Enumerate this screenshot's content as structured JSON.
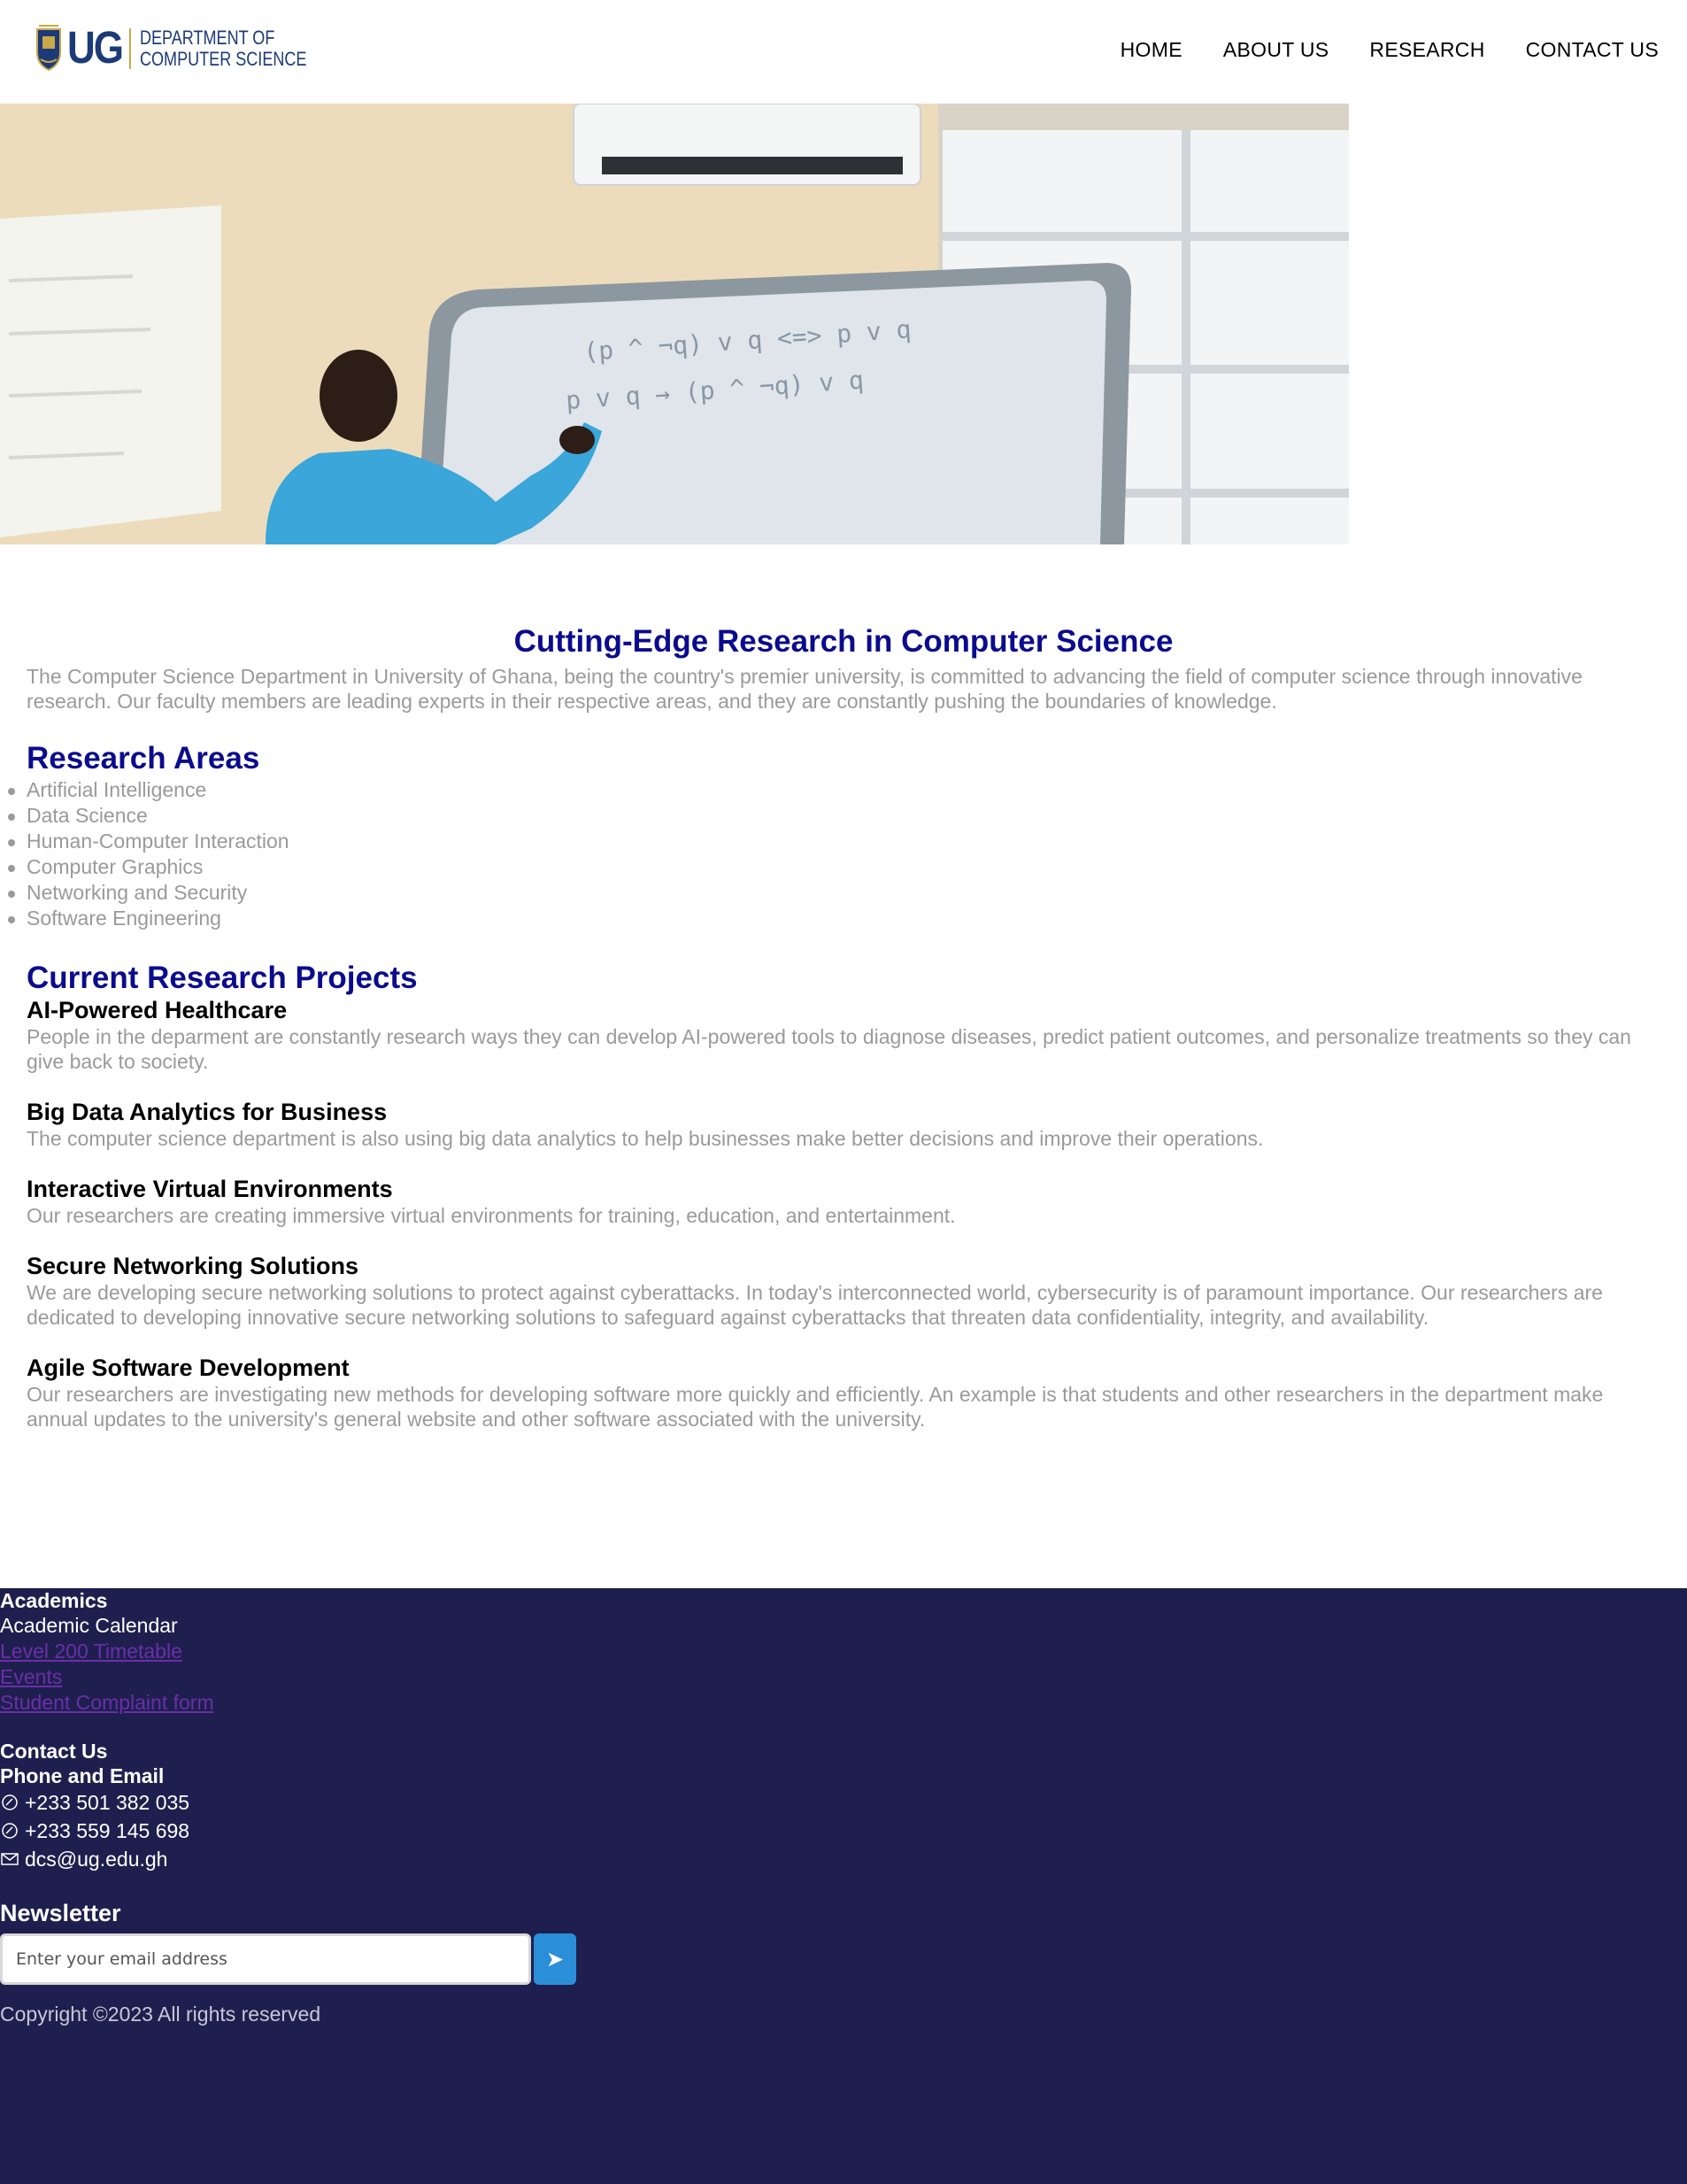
{
  "header": {
    "logo_abbr": "UG",
    "logo_line1": "DEPARTMENT OF",
    "logo_line2": "COMPUTER SCIENCE",
    "nav": [
      "HOME",
      "ABOUT US",
      "RESEARCH",
      "CONTACT US"
    ]
  },
  "main": {
    "title": "Cutting-Edge Research in Computer Science",
    "intro": "The Computer Science Department in University of Ghana, being the country's premier university, is committed to advancing the field of computer science through innovative research. Our faculty members are leading experts in their respective areas, and they are constantly pushing the boundaries of knowledge.",
    "areas_title": "Research Areas",
    "areas": [
      "Artificial Intelligence",
      "Data Science",
      "Human-Computer Interaction",
      "Computer Graphics",
      "Networking and Security",
      "Software Engineering"
    ],
    "projects_title": "Current Research Projects",
    "projects": [
      {
        "title": "AI-Powered Healthcare",
        "text": "People in the deparment are constantly research ways they can develop AI-powered tools to diagnose diseases, predict patient outcomes, and personalize treatments so they can give back to society."
      },
      {
        "title": "Big Data Analytics for Business",
        "text": "The computer science department is also using big data analytics to help businesses make better decisions and improve their operations."
      },
      {
        "title": "Interactive Virtual Environments",
        "text": "Our researchers are creating immersive virtual environments for training, education, and entertainment."
      },
      {
        "title": "Secure Networking Solutions",
        "text": "We are developing secure networking solutions to protect against cyberattacks. In today's interconnected world, cybersecurity is of paramount importance. Our researchers are dedicated to developing innovative secure networking solutions to safeguard against cyberattacks that threaten data confidentiality, integrity, and availability."
      },
      {
        "title": "Agile Software Development",
        "text": "Our researchers are investigating new methods for developing software more quickly and efficiently. An example is that students and other researchers in the department make annual updates to the university's general website and other software associated with the university."
      }
    ]
  },
  "hero": {
    "board_line1": "(p ^ ¬q) v q   <=>  p v q",
    "board_line2": "p v q  →  (p ^ ¬q) v q"
  },
  "footer": {
    "academics_title": "Academics",
    "academic_calendar": "Academic Calendar",
    "links": [
      "Level 200 Timetable",
      "Events",
      "Student Complaint form"
    ],
    "contact_title": "Contact Us",
    "phone_email_title": "Phone and Email",
    "phone1": "+233 501 382 035",
    "phone2": "+233 559 145 698",
    "email": "dcs@ug.edu.gh",
    "newsletter_title": "Newsletter",
    "newsletter_placeholder": "Enter your email address",
    "submit_icon": "send-icon",
    "copyright": "Copyright ©2023 All rights reserved"
  },
  "colors": {
    "heading_blue": "#0b0b8e",
    "footer_bg": "#1f1f4f",
    "link_purple": "#6a2fa8",
    "button_blue": "#2a8fd8"
  }
}
